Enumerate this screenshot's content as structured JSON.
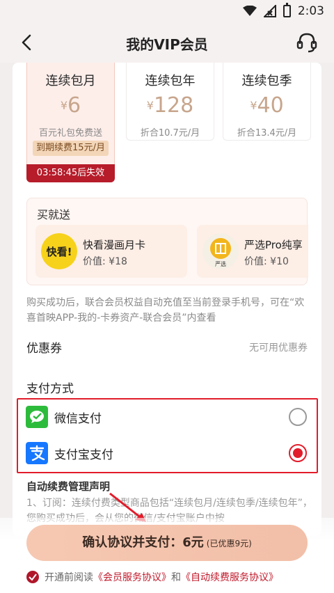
{
  "status_bar": {
    "time": "2:03"
  },
  "nav": {
    "title": "我的VIP会员"
  },
  "plans": [
    {
      "name": "连续包月",
      "currency": "¥",
      "price": "6",
      "subtitle": "百元礼包免费送",
      "renew": "到期续费15元/月",
      "timer": "03:58:45后失效"
    },
    {
      "name": "连续包年",
      "currency": "¥",
      "price": "128",
      "subtitle": "折合10.7元/月"
    },
    {
      "name": "连续包季",
      "currency": "¥",
      "price": "40",
      "subtitle": "折合13.4元/月"
    }
  ],
  "bonus": {
    "title": "买就送",
    "items": [
      {
        "name": "快看漫画月卡",
        "value": "价值: ¥18",
        "logo_text": "快看!"
      },
      {
        "name": "严选Pro纯享",
        "value": "价值: ¥10",
        "logo_text": "严选"
      }
    ]
  },
  "note": "购买成功后，联合会员权益自动充值至当前登录手机号，可在“欢喜首映APP-我的-卡券资产-联合会员”内查看",
  "coupon": {
    "label": "优惠券",
    "value": "无可用优惠券"
  },
  "payment": {
    "label": "支付方式",
    "methods": [
      {
        "name": "微信支付",
        "selected": false
      },
      {
        "name": "支付宝支付",
        "selected": true
      }
    ]
  },
  "renew_statement": {
    "title": "自动续费管理声明",
    "text": "1、订阅：连续付费类型商品包括“连续包月/连续包季/连续包年”，您购买成功后，会从您的微信/支付宝账户中按"
  },
  "pay_button": {
    "label": "确认协议并支付：6元",
    "discount": "(已优惠9元)"
  },
  "agreement": {
    "prefix": "开通前阅读",
    "link1": "《会员服务协议》",
    "joiner": "和",
    "link2": "《自动续费服务协议》"
  },
  "colors": {
    "accent_red": "#e21c2a",
    "price_gold": "#c7a58c",
    "timer_red": "#b71c2a"
  }
}
